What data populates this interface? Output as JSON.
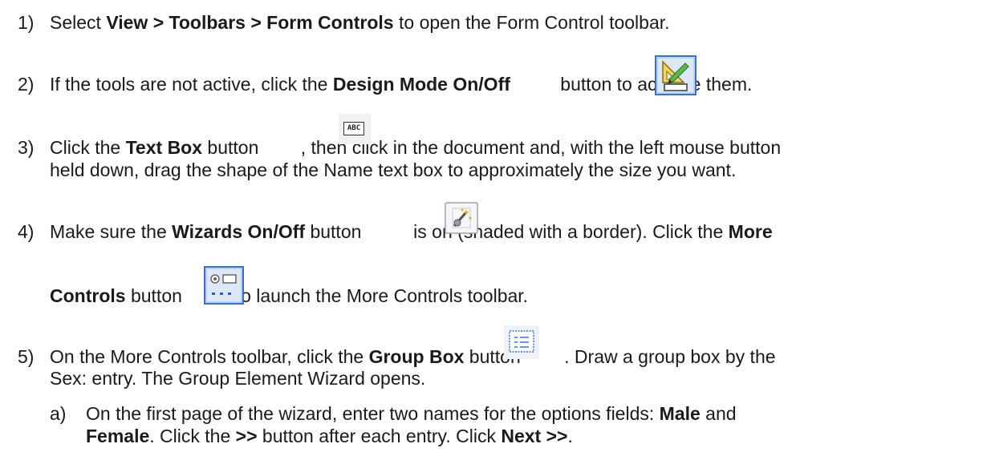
{
  "steps": [
    {
      "num": "1)",
      "pre": "Select ",
      "b1": "View > Toolbars > Form Controls",
      "post": " to open the Form Control toolbar."
    },
    {
      "num": "2)",
      "pre": "If the tools are not active, click the ",
      "b1": "Design Mode On/Off",
      "post": " button to activate them."
    },
    {
      "num": "3)",
      "pre": "Click the ",
      "b1": "Text Box",
      "mid": " button ",
      "post": ", then click in the document and, with the left mouse button",
      "line2": "held down, drag the shape of the Name text box to approximately the size you want."
    },
    {
      "num": "4)",
      "pre": "Make sure the ",
      "b1": "Wizards On/Off",
      "mid": " button ",
      "post": " is on (shaded with a border). Click the ",
      "b2": "More",
      "l2b": "Controls",
      "l2mid": " button ",
      "l2post": " to launch the More Controls toolbar."
    },
    {
      "num": "5)",
      "pre": "On the More Controls toolbar, click the ",
      "b1": "Group Box",
      "mid": " button ",
      "post": ". Draw a group box by the",
      "line2": "Sex: entry. The Group Element Wizard opens."
    }
  ],
  "substep": {
    "label": "a)",
    "l1pre": "On the first page of the wizard, enter two names for the options fields: ",
    "l1b": "Male",
    "l1post": " and",
    "l2b1": "Female",
    "l2mid": ". Click the ",
    "l2b2": ">>",
    "l2mid2": " button after each entry. Click ",
    "l2b3": "Next >>",
    "l2post": "."
  },
  "icons": {
    "design_mode": "design-mode-icon",
    "text_box": "text-box-icon",
    "text_box_glyph": "ABC",
    "wizards": "wizard-wand-icon",
    "more_controls": "more-controls-icon",
    "group_box": "group-box-icon"
  }
}
